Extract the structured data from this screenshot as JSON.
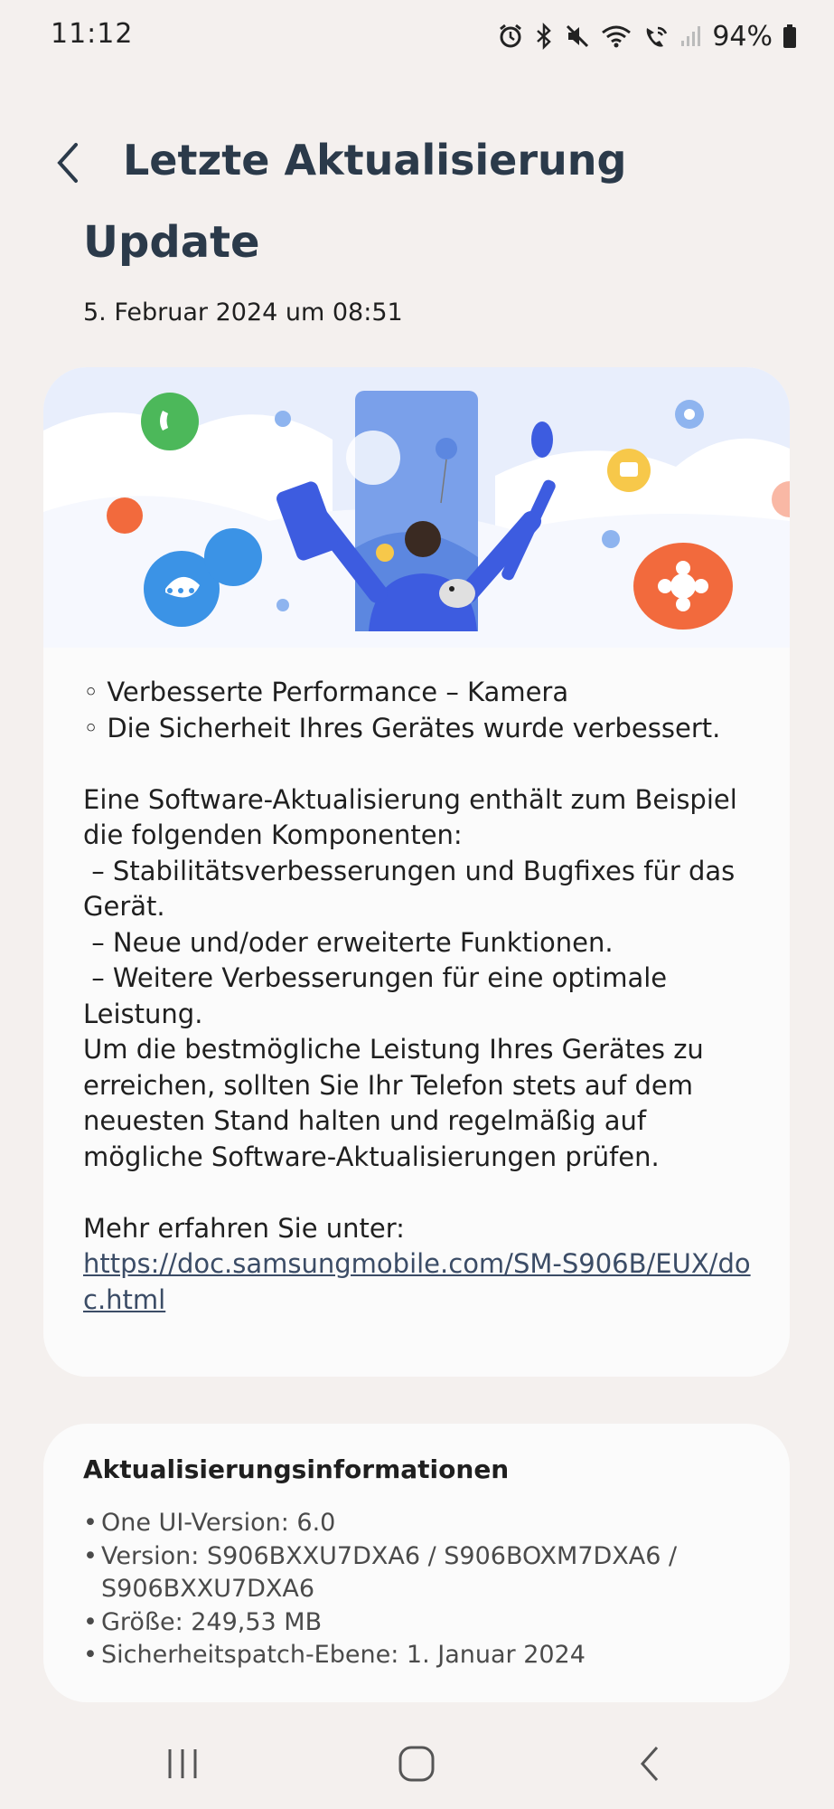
{
  "status_bar": {
    "time": "11:12",
    "battery": "94%",
    "icons": [
      "alarm-icon",
      "bluetooth-icon",
      "mute-icon",
      "wifi-icon",
      "wifi-calling-icon",
      "signal-icon",
      "battery-icon"
    ]
  },
  "header": {
    "title": "Letzte Aktualisierung",
    "back_icon": "chevron-left-icon"
  },
  "update": {
    "title": "Update",
    "date": "5. Februar 2024 um 08:51"
  },
  "notes": {
    "bullets": [
      "◦ Verbesserte Performance – Kamera",
      "◦ Die Sicherheit Ihres Gerätes wurde verbessert."
    ],
    "intro": "Eine Software-Aktualisierung enthält zum Beispiel die folgenden Komponenten:",
    "components": [
      " – Stabilitätsverbesserungen und Bugfixes für das Gerät.",
      " – Neue und/oder erweiterte Funktionen.",
      " – Weitere Verbesserungen für eine optimale Leistung."
    ],
    "advice": "Um die bestmögliche Leistung Ihres Gerätes zu erreichen, sollten Sie Ihr Telefon stets auf dem neuesten Stand halten und regelmäßig auf mögliche Software-Aktualisierungen prüfen.",
    "more_label": "Mehr erfahren Sie unter:",
    "link": "https://doc.samsungmobile.com/SM-S906B/EUX/doc.html"
  },
  "info": {
    "title": "Aktualisierungsinformationen",
    "items": [
      "One UI-Version: 6.0",
      "Version: S906BXXU7DXA6 / S906BOXM7DXA6 / S906BXXU7DXA6",
      "Größe: 249,53 MB",
      "Sicherheitspatch-Ebene: 1. Januar 2024"
    ]
  },
  "nav": {
    "recent_icon": "recent-apps-icon",
    "home_icon": "home-icon",
    "back_icon": "back-icon"
  },
  "colors": {
    "background": "#f4f0ee",
    "card": "#fbfbfb",
    "title": "#2b3a4a",
    "link": "#3b4c66",
    "accent_blue": "#3d5ce0",
    "accent_orange": "#f26a3d"
  }
}
